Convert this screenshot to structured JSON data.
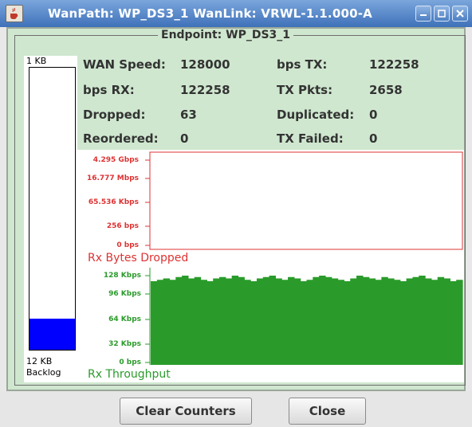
{
  "window": {
    "title": "WanPath: WP_DS3_1 WanLink: VRWL-1.1.000-A",
    "accent": "#4a7cc2"
  },
  "group": {
    "title": "Endpoint: WP_DS3_1"
  },
  "backlog": {
    "top_label": "1 KB",
    "bottom_value": "12 KB",
    "bottom_label": "Backlog",
    "fill_fraction": 0.11,
    "fill_color": "#0000ff"
  },
  "stats": [
    {
      "label": "WAN Speed:",
      "value": "128000"
    },
    {
      "label": "bps TX:",
      "value": "122258"
    },
    {
      "label": "bps RX:",
      "value": "122258"
    },
    {
      "label": "TX Pkts:",
      "value": "2658"
    },
    {
      "label": "Dropped:",
      "value": "63"
    },
    {
      "label": "Duplicated:",
      "value": "0"
    },
    {
      "label": "Reordered:",
      "value": "0"
    },
    {
      "label": "TX Failed:",
      "value": "0"
    }
  ],
  "chart_data": [
    {
      "type": "area",
      "title": "Rx Bytes Dropped",
      "y_ticks": [
        "4.295 Gbps",
        "16.777 Mbps",
        "65.536 Kbps",
        "256 bps",
        "0 bps"
      ],
      "color": "#dd3333",
      "values": []
    },
    {
      "type": "area",
      "title": "Rx Throughput",
      "y_ticks": [
        "128 Kbps",
        "96 Kbps",
        "64 Kbps",
        "32 Kbps",
        "0 bps"
      ],
      "ylim": [
        0,
        128
      ],
      "color": "#2a9b2a",
      "values": [
        120,
        122,
        124,
        122,
        126,
        128,
        124,
        126,
        122,
        120,
        124,
        126,
        124,
        128,
        126,
        122,
        120,
        124,
        126,
        128,
        124,
        122,
        126,
        124,
        120,
        122,
        126,
        128,
        126,
        124,
        122,
        120,
        124,
        128,
        126,
        124,
        122,
        126,
        124,
        122,
        120,
        124,
        126,
        128,
        124,
        122,
        126,
        124,
        120,
        122
      ]
    }
  ],
  "buttons": {
    "clear": "Clear Counters",
    "close": "Close"
  }
}
